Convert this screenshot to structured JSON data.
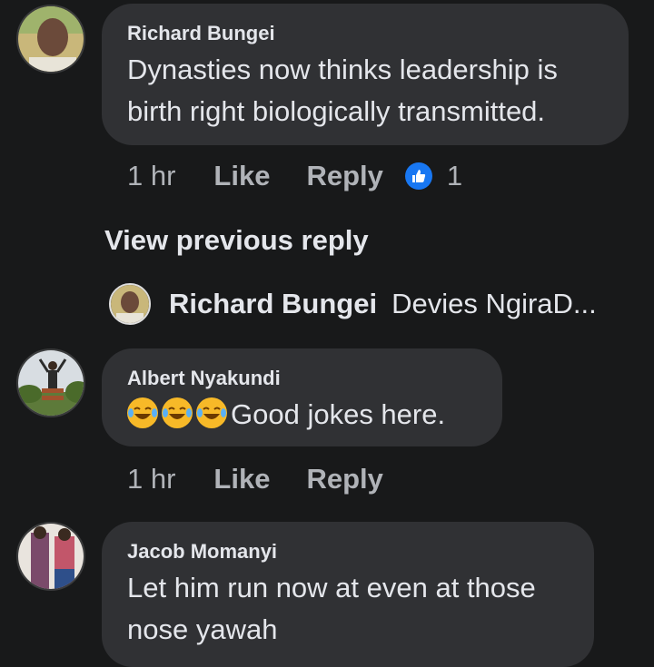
{
  "comments": [
    {
      "author": "Richard Bungei",
      "lines": [
        "Dynasties now thinks leadership  is",
        "birth right biologically transmitted."
      ],
      "time": "1 hr",
      "like_label": "Like",
      "reply_label": "Reply",
      "reaction_count": "1"
    },
    {
      "author": "Albert Nyakundi",
      "text": "Good jokes here.",
      "time": "1 hr",
      "like_label": "Like",
      "reply_label": "Reply"
    },
    {
      "author": "Jacob Momanyi",
      "lines": [
        "Let him run now at even at those",
        "nose yawah"
      ]
    }
  ],
  "thread": {
    "view_previous_label": "View previous reply",
    "preview_author": "Richard Bungei",
    "preview_text": "Devies NgiraD..."
  },
  "colors": {
    "background": "#18191a",
    "bubble": "#303134",
    "like_reaction": "#1877f2",
    "emoji": "#f7b928"
  },
  "icons": {
    "reaction": "thumbs-up-icon",
    "emoji": "laughing-crying-emoji"
  }
}
